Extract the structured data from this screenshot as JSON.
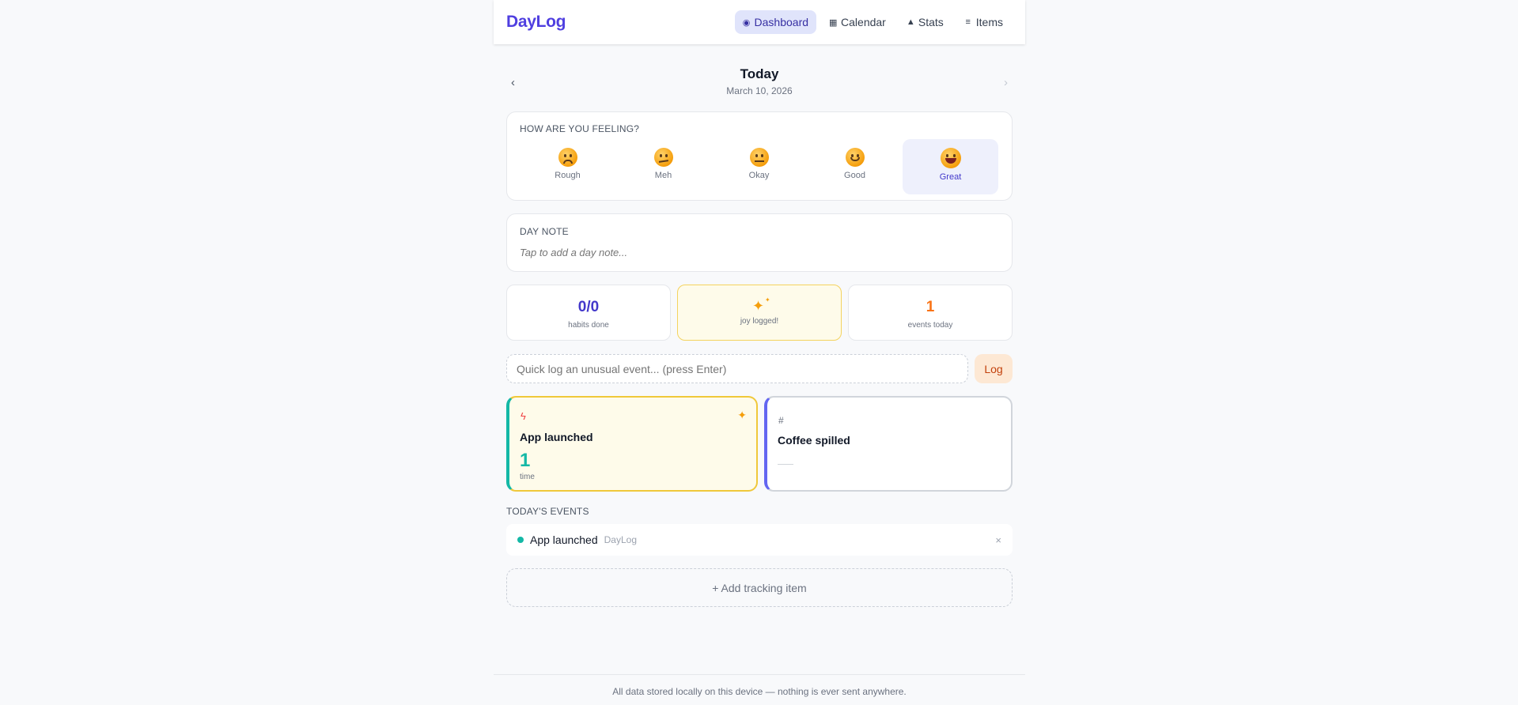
{
  "header": {
    "brand": "DayLog",
    "nav": [
      {
        "label": "Dashboard",
        "icon": "◉",
        "icon_name": "dashboard-icon",
        "active": true
      },
      {
        "label": "Calendar",
        "icon": "▦",
        "icon_name": "calendar-icon",
        "active": false
      },
      {
        "label": "Stats",
        "icon": "▲",
        "icon_name": "stats-icon",
        "active": false
      },
      {
        "label": "Items",
        "icon": "≡",
        "icon_name": "items-icon",
        "active": false
      }
    ]
  },
  "day": {
    "title": "Today",
    "date": "March 10, 2026",
    "prev_icon": "‹",
    "next_icon": "›"
  },
  "mood": {
    "label": "How are you feeling?",
    "options": [
      "Rough",
      "Meh",
      "Okay",
      "Good",
      "Great"
    ],
    "selected": "Great"
  },
  "note": {
    "label": "Day note",
    "placeholder": "Tap to add a day note..."
  },
  "stats": {
    "habits_value": "0/0",
    "habits_label": "habits done",
    "joy_label": "joy logged!",
    "events_value": "1",
    "events_label": "events today"
  },
  "quick_log": {
    "placeholder": "Quick log an unusual event... (press Enter)",
    "button": "Log"
  },
  "tracking": [
    {
      "icon": "ϟ",
      "title": "App launched",
      "count": "1",
      "unit": "time",
      "joy": true
    },
    {
      "icon": "#",
      "title": "Coffee spilled"
    }
  ],
  "events": {
    "label": "Today's events",
    "items": [
      {
        "name": "App launched",
        "source": "DayLog",
        "remove": "×"
      }
    ]
  },
  "add_item": "+ Add tracking item",
  "footer": "All data stored locally on this device — nothing is ever sent anywhere.",
  "colors": {
    "brand": "#4f3fe0",
    "teal": "#14b8a6",
    "orange": "#f97316",
    "indigo": "#6366f1"
  }
}
